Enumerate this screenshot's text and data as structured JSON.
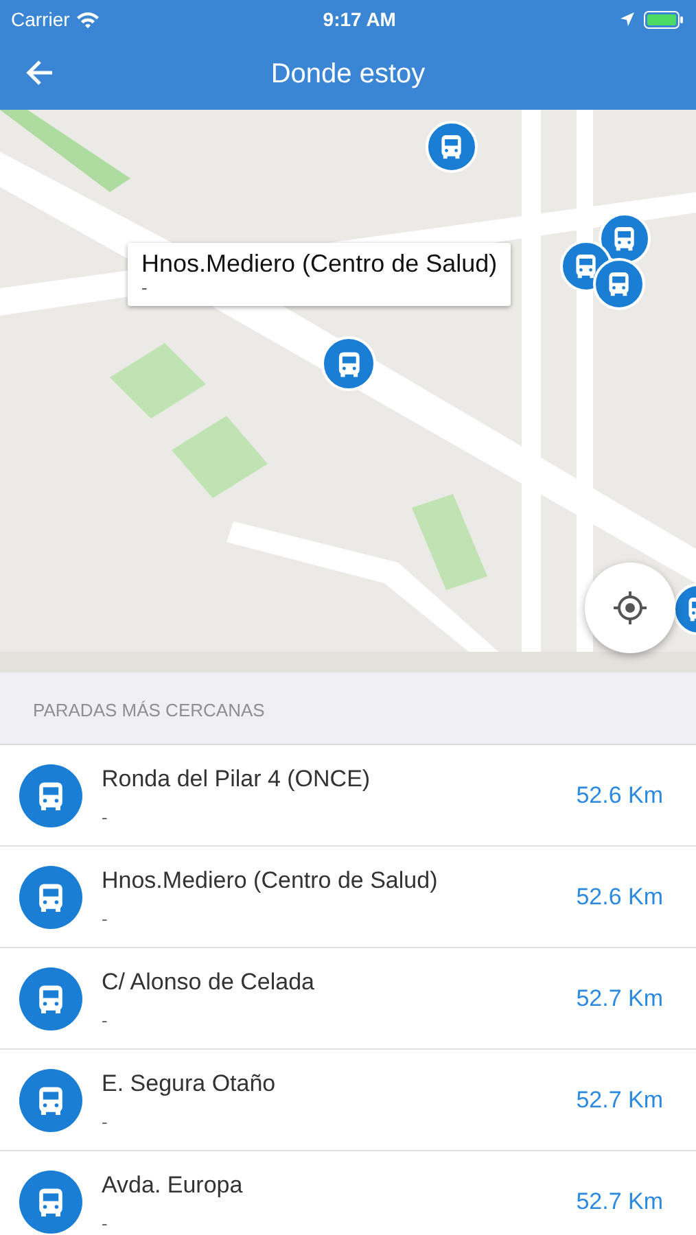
{
  "status_bar": {
    "carrier": "Carrier",
    "time": "9:17 AM"
  },
  "nav": {
    "title": "Donde estoy"
  },
  "map": {
    "callout": {
      "title": "Hnos.Mediero (Centro de Salud)",
      "subtitle": "-"
    }
  },
  "section": "PARADAS MÁS CERCANAS",
  "stops": [
    {
      "name": "Ronda del Pilar 4 (ONCE)",
      "detail": "-",
      "distance": "52.6 Km"
    },
    {
      "name": "Hnos.Mediero (Centro de Salud)",
      "detail": "-",
      "distance": "52.6 Km"
    },
    {
      "name": "C/ Alonso de Celada",
      "detail": "-",
      "distance": "52.7 Km"
    },
    {
      "name": "E. Segura Otaño",
      "detail": "-",
      "distance": "52.7 Km"
    },
    {
      "name": "Avda. Europa",
      "detail": "-",
      "distance": "52.7 Km"
    }
  ]
}
